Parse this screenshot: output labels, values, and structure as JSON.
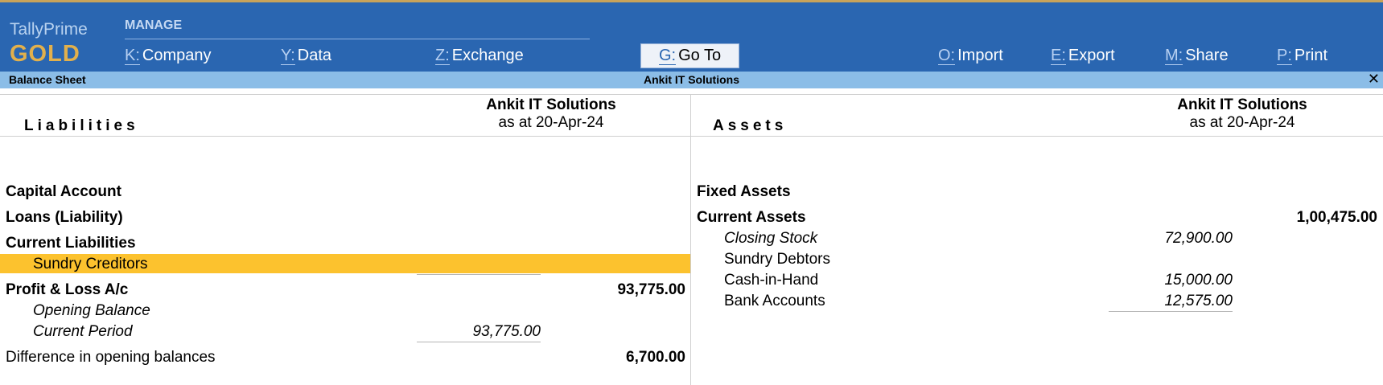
{
  "brand": {
    "name": "TallyPrime",
    "tier": "GOLD"
  },
  "header": {
    "section_label": "MANAGE",
    "menu": [
      {
        "key": "K:",
        "label": "Company"
      },
      {
        "key": "Y:",
        "label": "Data"
      },
      {
        "key": "Z:",
        "label": "Exchange"
      },
      {
        "key": "G:",
        "label": "Go To"
      },
      {
        "key": "O:",
        "label": "Import"
      },
      {
        "key": "E:",
        "label": "Export"
      },
      {
        "key": "M:",
        "label": "Share"
      },
      {
        "key": "P:",
        "label": "Print"
      }
    ]
  },
  "titlebar": {
    "report": "Balance Sheet",
    "company": "Ankit IT Solutions",
    "close": "✕"
  },
  "liabilities": {
    "heading": "Liabilities",
    "company": "Ankit IT Solutions",
    "date": "as at 20-Apr-24",
    "rows": {
      "capital": {
        "label": "Capital Account"
      },
      "loans": {
        "label": "Loans (Liability)"
      },
      "current_liabilities": {
        "label": "Current Liabilities"
      },
      "sundry_creditors": {
        "label": "Sundry Creditors"
      },
      "profit_loss": {
        "label": "Profit & Loss A/c",
        "amount": "93,775.00"
      },
      "opening_balance": {
        "label": "Opening Balance"
      },
      "current_period": {
        "label": "Current Period",
        "amount": "93,775.00"
      },
      "difference": {
        "label": "Difference in opening balances",
        "amount": "6,700.00"
      }
    }
  },
  "assets": {
    "heading": "Assets",
    "company": "Ankit IT Solutions",
    "date": "as at 20-Apr-24",
    "rows": {
      "fixed_assets": {
        "label": "Fixed Assets"
      },
      "current_assets": {
        "label": "Current Assets",
        "amount": "1,00,475.00"
      },
      "closing_stock": {
        "label": "Closing Stock",
        "amount": "72,900.00"
      },
      "sundry_debtors": {
        "label": "Sundry Debtors"
      },
      "cash_in_hand": {
        "label": "Cash-in-Hand",
        "amount": "15,000.00"
      },
      "bank_accounts": {
        "label": "Bank Accounts",
        "amount": "12,575.00"
      }
    }
  },
  "colors": {
    "header_bg": "#2a66b1",
    "titlebar_bg": "#8bbde7",
    "highlight": "#fcc22e",
    "brand_tier": "#e2b04c"
  }
}
